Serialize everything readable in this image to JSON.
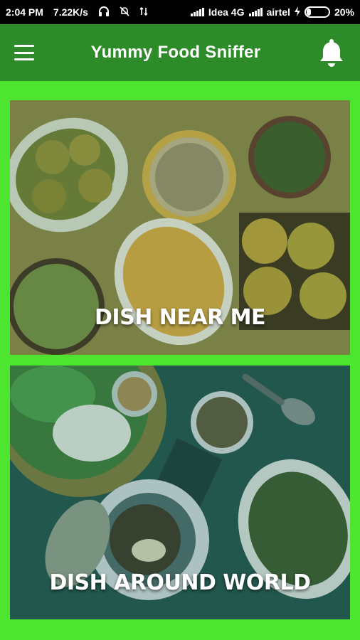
{
  "status_bar": {
    "time": "2:04 PM",
    "speed": "7.22K/s",
    "carrier1": "Idea 4G",
    "carrier2": "airtel",
    "battery": "20%",
    "battery_level": 0.2
  },
  "app_bar": {
    "title": "Yummy Food Sniffer",
    "menu_icon": "hamburger-menu-icon",
    "notification_icon": "bell-icon"
  },
  "cards": {
    "near": {
      "label": "DISH NEAR ME"
    },
    "world": {
      "label": "DISH AROUND WORLD"
    }
  },
  "colors": {
    "background": "#4de52f",
    "app_bar": "#2e8b2a",
    "status_bar": "#000000"
  }
}
